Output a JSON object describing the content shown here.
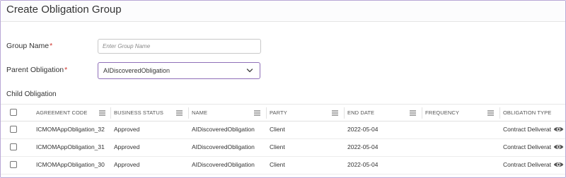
{
  "header": {
    "title": "Create Obligation Group"
  },
  "form": {
    "group_name": {
      "label": "Group Name",
      "required_mark": "*",
      "value": "",
      "placeholder": "Enter Group Name"
    },
    "parent_obligation": {
      "label": "Parent Obligation",
      "required_mark": "*",
      "selected": "AIDiscoveredObligation"
    },
    "child_label": "Child Obligation"
  },
  "table": {
    "columns": [
      "AGREEMENT CODE",
      "BUSINESS STATUS",
      "NAME",
      "PARTY",
      "END DATE",
      "FREQUENCY",
      "OBLIGATION TYPE"
    ],
    "rows": [
      {
        "agreement_code": "ICMOMAppObligation_32",
        "business_status": "Approved",
        "name": "AIDiscoveredObligation",
        "party": "Client",
        "end_date": "2022-05-04",
        "frequency": "",
        "obligation_type": "Contract Deliverat"
      },
      {
        "agreement_code": "ICMOMAppObligation_31",
        "business_status": "Approved",
        "name": "AIDiscoveredObligation",
        "party": "Client",
        "end_date": "2022-05-04",
        "frequency": "",
        "obligation_type": "Contract Deliverat"
      },
      {
        "agreement_code": "ICMOMAppObligation_30",
        "business_status": "Approved",
        "name": "AIDiscoveredObligation",
        "party": "Client",
        "end_date": "2022-05-04",
        "frequency": "",
        "obligation_type": "Contract Deliverat"
      }
    ]
  },
  "icons": {
    "column_menu": "hamburger-menu-icon",
    "row_action": "eye-icon",
    "dropdown": "chevron-down-icon"
  },
  "colors": {
    "accent_border": "#8f6fb8",
    "required": "#d0342c",
    "frame_border": "#b9a8d6"
  }
}
